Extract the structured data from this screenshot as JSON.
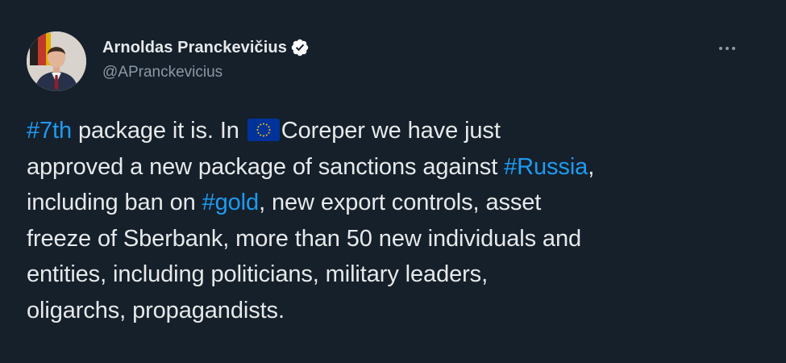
{
  "author": {
    "display_name": "Arnoldas Pranckevičius",
    "handle": "@APranckevicius",
    "verified": true
  },
  "tweet": {
    "line1": {
      "hashtag": "#7th",
      "text_a": " package it is. In ",
      "flag_icon": "eu-flag-icon",
      "text_b": "Coreper we have just"
    },
    "line2": {
      "text_a": "approved a new package of sanctions against ",
      "hashtag": "#Russia",
      "text_b": ","
    },
    "line3": {
      "text_a": "including ban on ",
      "hashtag": "#gold",
      "text_b": ", new export controls, asset"
    },
    "line4": {
      "text": "freeze of Sberbank, more than 50 new individuals and"
    },
    "line5": {
      "text": "entities, including politicians, military leaders,"
    },
    "line6": {
      "text": "oligarchs, propagandists."
    }
  },
  "icons": {
    "verified": "verified-badge-icon",
    "more": "more-options-icon"
  },
  "colors": {
    "background": "#15202b",
    "text": "#e7e9ea",
    "secondary_text": "#8b98a5",
    "link": "#1d9bf0",
    "eu_blue": "#003399",
    "eu_yellow": "#ffcc00"
  }
}
